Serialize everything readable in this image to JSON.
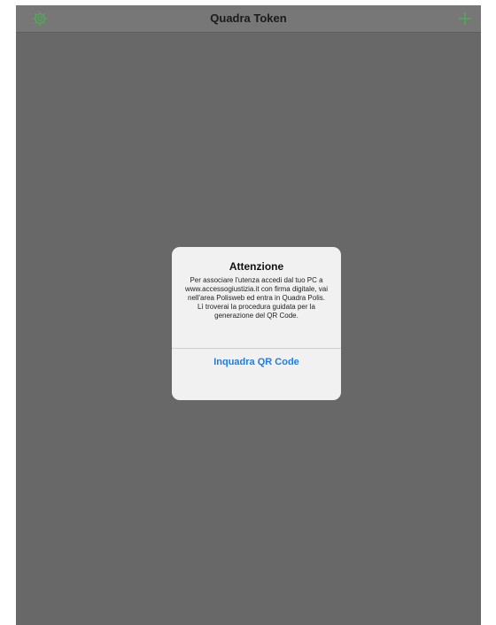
{
  "navbar": {
    "title": "Quadra Token",
    "left_icon": "gear-icon",
    "right_icon": "plus-icon",
    "accent_color": "#4caf50"
  },
  "alert": {
    "title": "Attenzione",
    "message": "Per associare l'utenza accedi dal tuo PC a www.accessogiustizia.it con firma digitale, vai nell'area Polisweb ed entra in Quadra Polis.\nLì troverai la procedura guidata per la generazione del QR Code.",
    "button_label": "Inquadra QR Code",
    "button_color": "#1b7fe3"
  }
}
